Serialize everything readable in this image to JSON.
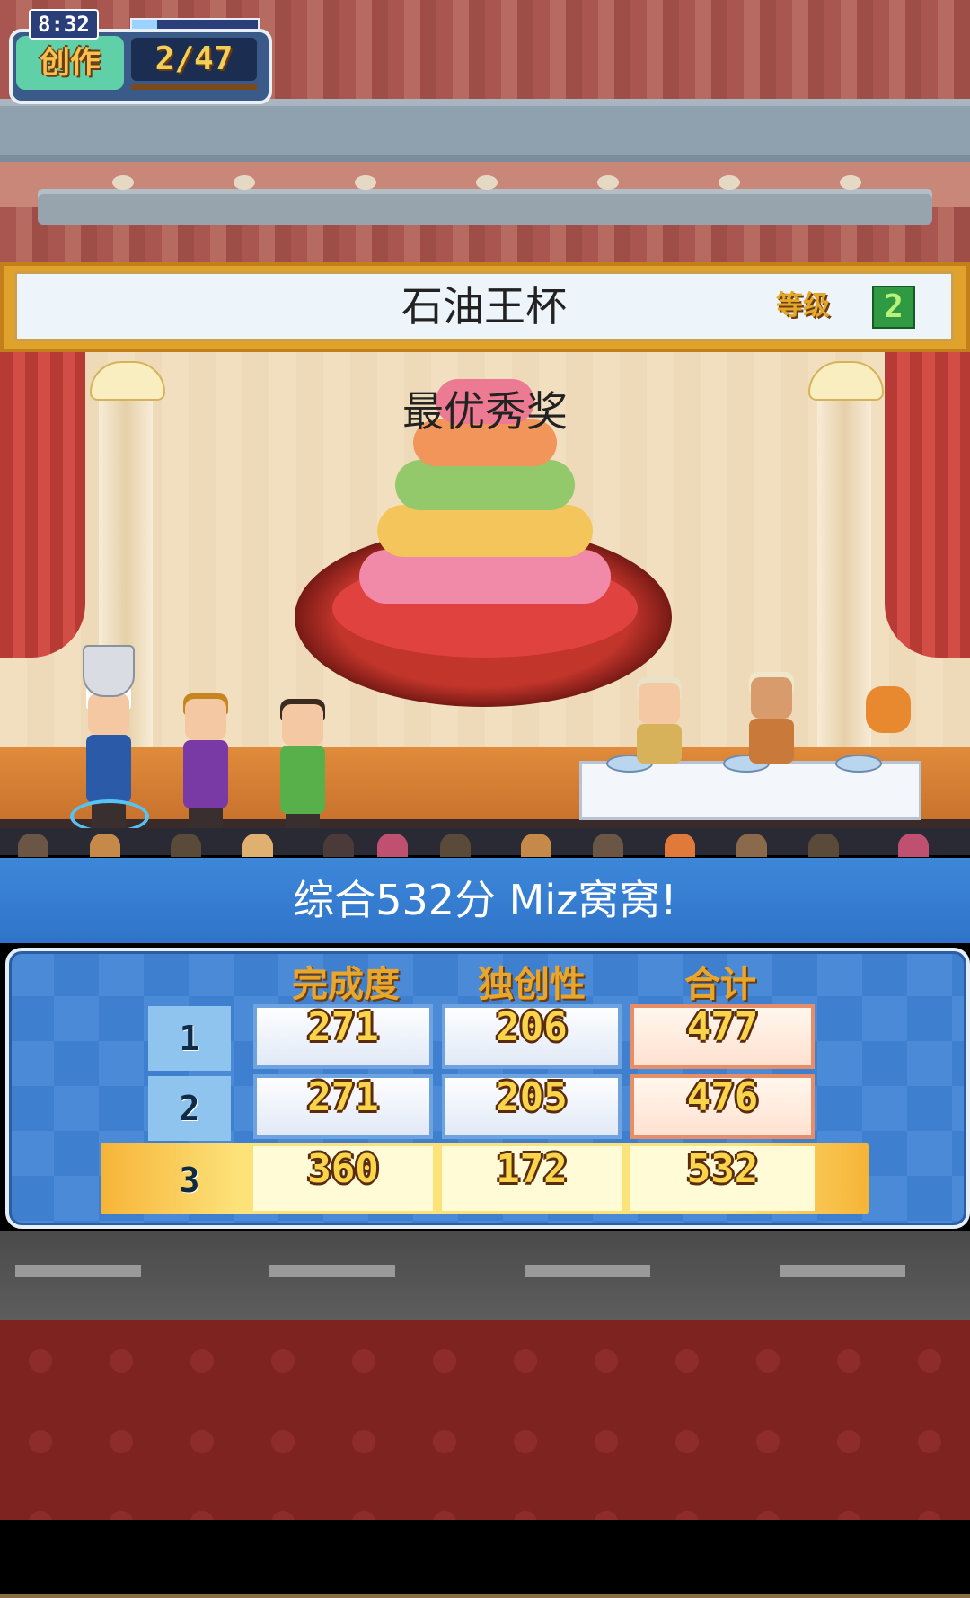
{
  "hud": {
    "clock": "8:32",
    "clock_progress": 0.2,
    "mode_label": "创作",
    "progress_count": "2/47"
  },
  "contest": {
    "title": "石油王杯",
    "grade_label": "等级",
    "grade_value": "2",
    "award": "最优秀奖"
  },
  "result": {
    "summary": "综合532分 Miz窝窝!"
  },
  "scoreboard": {
    "headers": [
      "完成度",
      "独创性",
      "合计"
    ],
    "rows": [
      {
        "rank": "1",
        "completion": "271",
        "originality": "206",
        "total": "477"
      },
      {
        "rank": "2",
        "completion": "271",
        "originality": "205",
        "total": "476"
      },
      {
        "rank": "3",
        "completion": "360",
        "originality": "172",
        "total": "532"
      }
    ],
    "winner_rank": "3"
  },
  "colors": {
    "accent_blue": "#3d87d9",
    "gold": "#e0a22a",
    "score_text": "#f8d54a"
  }
}
